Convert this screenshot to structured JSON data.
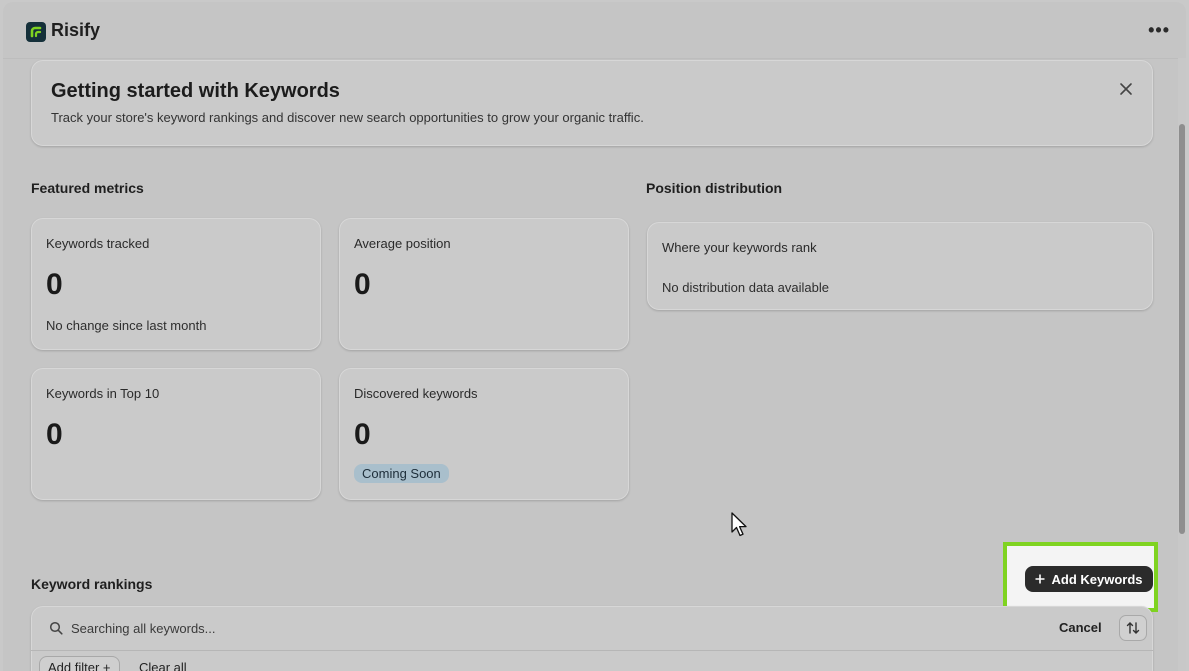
{
  "app": {
    "name": "Risify"
  },
  "banner": {
    "title": "Getting started with Keywords",
    "subtitle": "Track your store's keyword rankings and discover new search opportunities to grow your organic traffic."
  },
  "featured_metrics": {
    "title": "Featured metrics",
    "cards": [
      {
        "label": "Keywords tracked",
        "value": "0",
        "note": "No change since last month"
      },
      {
        "label": "Average position",
        "value": "0"
      },
      {
        "label": "Keywords in Top 10",
        "value": "0"
      },
      {
        "label": "Discovered keywords",
        "value": "0",
        "badge": "Coming Soon"
      }
    ]
  },
  "position_distribution": {
    "title": "Position distribution",
    "card_label": "Where your keywords rank",
    "empty_text": "No distribution data available"
  },
  "keyword_rankings": {
    "title": "Keyword rankings",
    "add_button": "Add Keywords",
    "add_button_icon": "plus-icon",
    "search_placeholder": "Searching all keywords...",
    "cancel_label": "Cancel",
    "add_filter_label": "Add filter +",
    "clear_all_label": "Clear all"
  },
  "colors": {
    "highlight": "#7fd321",
    "primary_button": "#2b2b2b",
    "badge": "#a9bfcc"
  }
}
